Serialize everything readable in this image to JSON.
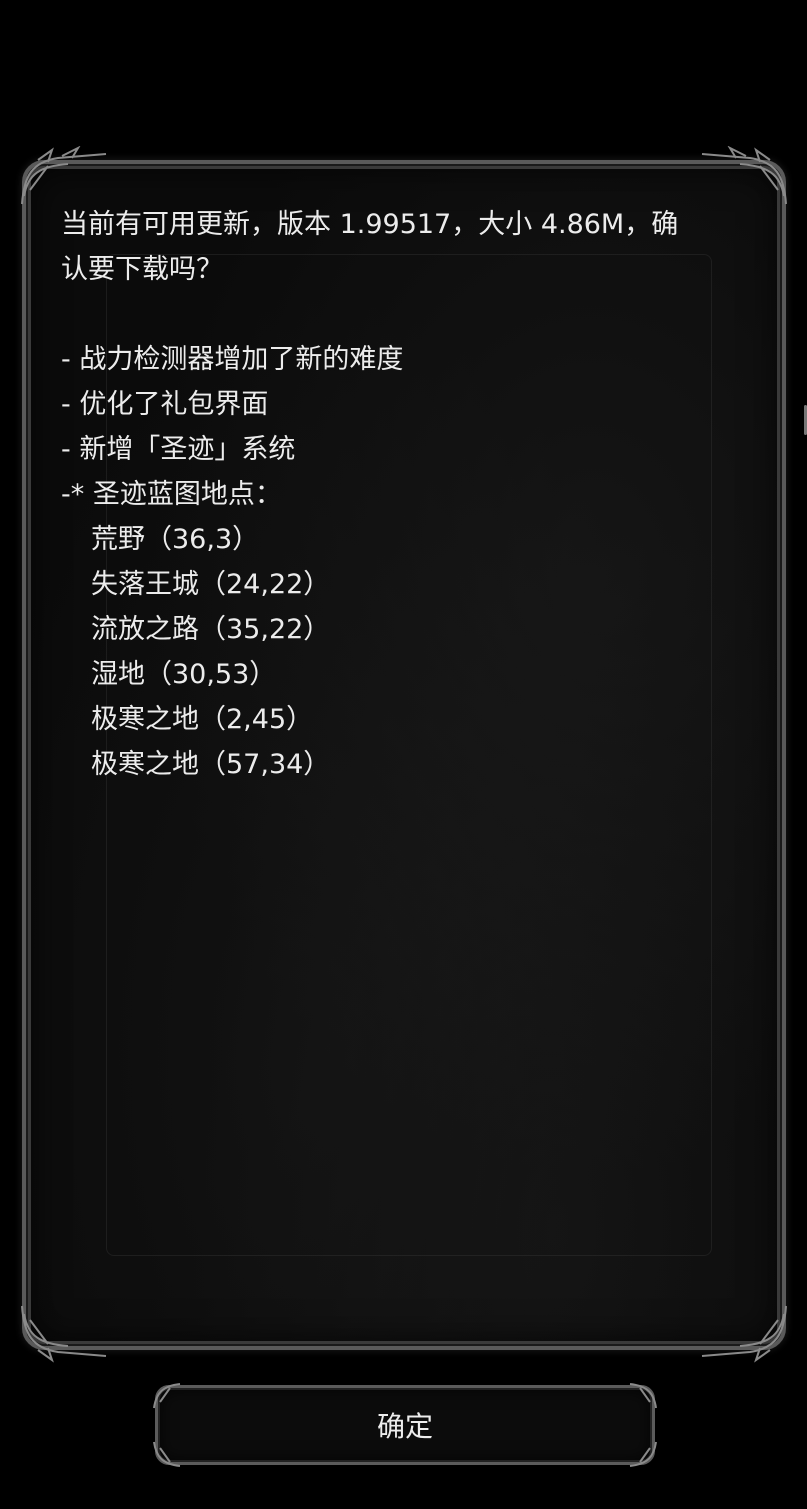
{
  "dialog": {
    "message_lines": [
      "当前有可用更新，版本 1.99517，大小 4.86M，确",
      "认要下载吗？",
      "",
      "- 战力检测器增加了新的难度",
      "- 优化了礼包界面",
      "- 新增「圣迹」系统",
      "-* 圣迹蓝图地点：",
      "荒野（36,3）",
      "失落王城（24,22）",
      "流放之路（35,22）",
      "湿地（30,53）",
      "极寒之地（2,45）",
      "极寒之地（57,34）"
    ],
    "confirm_label": "确定"
  },
  "colors": {
    "background": "#000000",
    "text": "#ececec",
    "frame": "#5a5a5a"
  },
  "icons": [
    "ornate-corner-icon"
  ]
}
